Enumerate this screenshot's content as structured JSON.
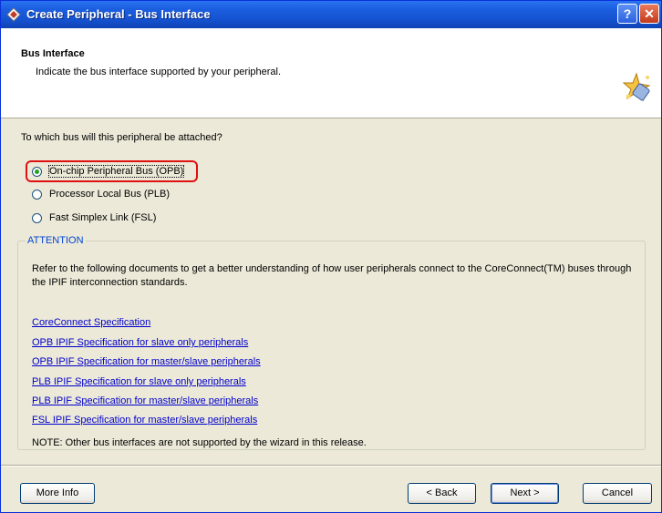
{
  "window": {
    "title": "Create Peripheral - Bus Interface",
    "help_label": "?",
    "close_label": "✕"
  },
  "header": {
    "title": "Bus Interface",
    "subtitle": "Indicate the bus interface supported by your peripheral."
  },
  "question": "To which bus will this peripheral be attached?",
  "bus_options": [
    {
      "label": "On-chip Peripheral Bus (OPB)",
      "selected": true
    },
    {
      "label": "Processor Local Bus (PLB)",
      "selected": false
    },
    {
      "label": "Fast Simplex Link (FSL)",
      "selected": false
    }
  ],
  "attention": {
    "legend": "ATTENTION",
    "text": "Refer to the following documents to get a better understanding of how user peripherals connect to the CoreConnect(TM) buses through the IPIF interconnection standards.",
    "links": [
      "CoreConnect Specification",
      "OPB IPIF Specification for slave only peripherals",
      "OPB IPIF Specification for master/slave peripherals",
      "PLB IPIF Specification for slave only peripherals",
      "PLB IPIF Specification for master/slave peripherals",
      "FSL IPIF Specification for master/slave peripherals"
    ],
    "note": "NOTE: Other bus interfaces are not supported by the wizard in this release."
  },
  "buttons": {
    "more_info": "More Info",
    "back": "< Back",
    "next": "Next >",
    "cancel": "Cancel"
  },
  "icons": {
    "title": "diamond-app-icon",
    "header": "wizard-sparkle-icon"
  },
  "colors": {
    "titlebar": "#1552d0",
    "link": "#0000cc",
    "attention_legend": "#0046d5",
    "highlight": "#e01010",
    "dialog_bg": "#ece9d8"
  }
}
